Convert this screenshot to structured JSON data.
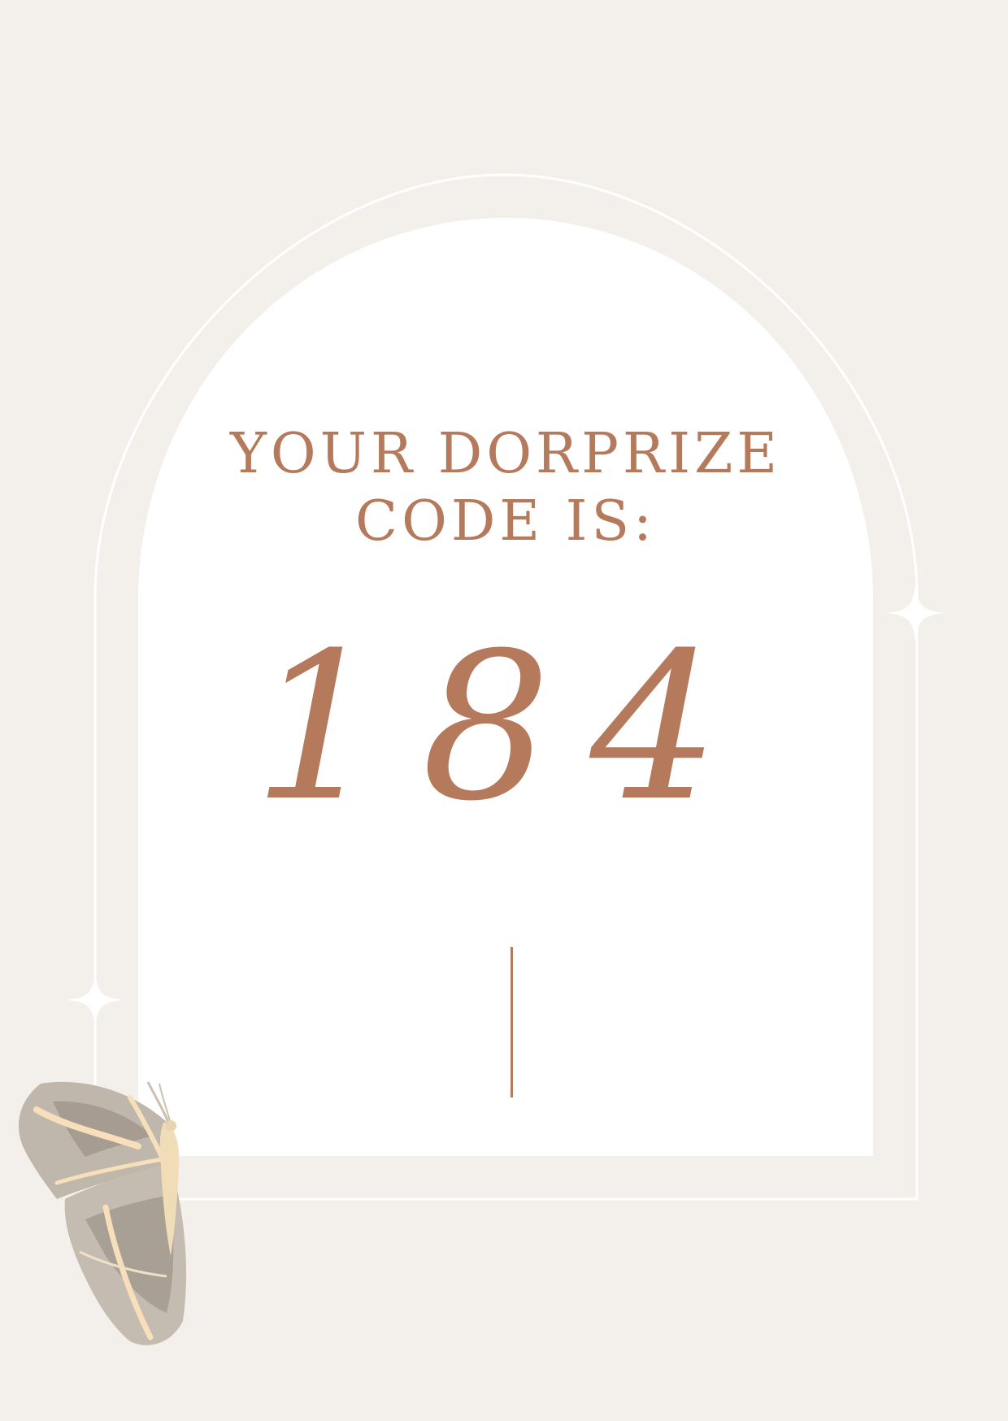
{
  "card": {
    "heading_line1": "YOUR DORPRIZE",
    "heading_line2": "CODE IS:",
    "code": "184"
  },
  "colors": {
    "background": "#f3f0eb",
    "arch": "#ffffff",
    "accent": "#b57a5c",
    "outline": "#ffffff"
  },
  "decorations": {
    "sparkle_icon": "four-point-sparkle",
    "moth_icon": "moth-illustration"
  }
}
